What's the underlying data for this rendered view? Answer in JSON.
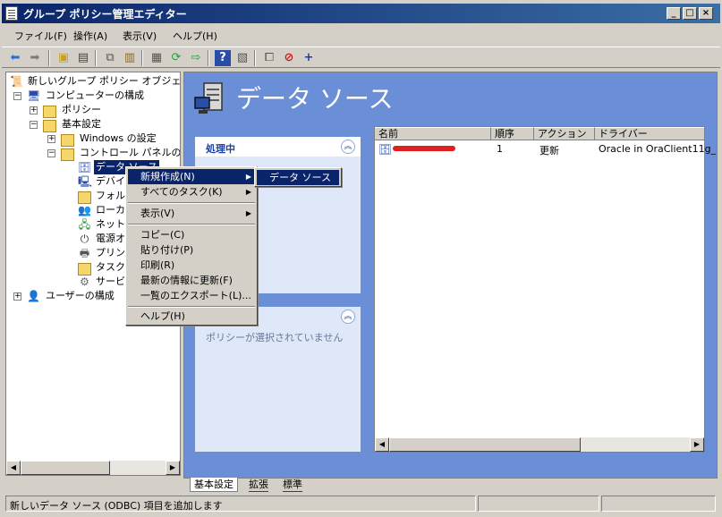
{
  "window": {
    "title": "グループ ポリシー管理エディター",
    "controls": {
      "minimize": "_",
      "maximize": "□",
      "close": "×"
    }
  },
  "menubar": [
    "ファイル(F)",
    "操作(A)",
    "表示(V)",
    "ヘルプ(H)"
  ],
  "toolbar": {
    "icons": [
      "back-arrow-icon",
      "forward-arrow-icon",
      "up-folder-icon",
      "show-hide-tree-icon",
      "copy-icon",
      "paste-icon",
      "print-icon",
      "refresh-icon",
      "export-icon",
      "help-icon",
      "properties-icon",
      "new-item-icon",
      "stop-icon",
      "add-icon"
    ]
  },
  "tree": {
    "root": "新しいグループ ポリシー オブジェクト",
    "computer": "コンピューターの構成",
    "policy": "ポリシー",
    "preferences": "基本設定",
    "windows_settings": "Windows の設定",
    "control_panel": "コントロール パネルの設",
    "items": [
      "データ ソース",
      "デバイ",
      "フォルダ",
      "ローカ",
      "ネットワ",
      "電源オ",
      "プリンタ",
      "タスク",
      "サービ"
    ],
    "user": "ユーザーの構成"
  },
  "header": {
    "title": "データ ソース"
  },
  "panels": {
    "processing": {
      "title": "処理中"
    },
    "description": {
      "text": "ポリシーが選択されていません"
    }
  },
  "list": {
    "columns": [
      "名前",
      "順序",
      "アクション",
      "ドライバー"
    ],
    "rows": [
      {
        "name": "",
        "order": "1",
        "action": "更新",
        "driver": "Oracle in OraClient11g_"
      }
    ]
  },
  "context_menu": {
    "items": [
      "新規作成(N)",
      "すべてのタスク(K)",
      "表示(V)",
      "コピー(C)",
      "貼り付け(P)",
      "印刷(R)",
      "最新の情報に更新(F)",
      "一覧のエクスポート(L)...",
      "ヘルプ(H)"
    ],
    "submenu": [
      "データ ソース"
    ]
  },
  "tabs": [
    "基本設定",
    "拡張",
    "標準"
  ],
  "status": {
    "text": "新しいデータ ソース (ODBC) 項目を追加します"
  },
  "colors": {
    "titlebar": "#0a246a",
    "right_pane_bg": "#6b8fd6",
    "selection": "#0a246a",
    "redaction": "#e02020"
  }
}
